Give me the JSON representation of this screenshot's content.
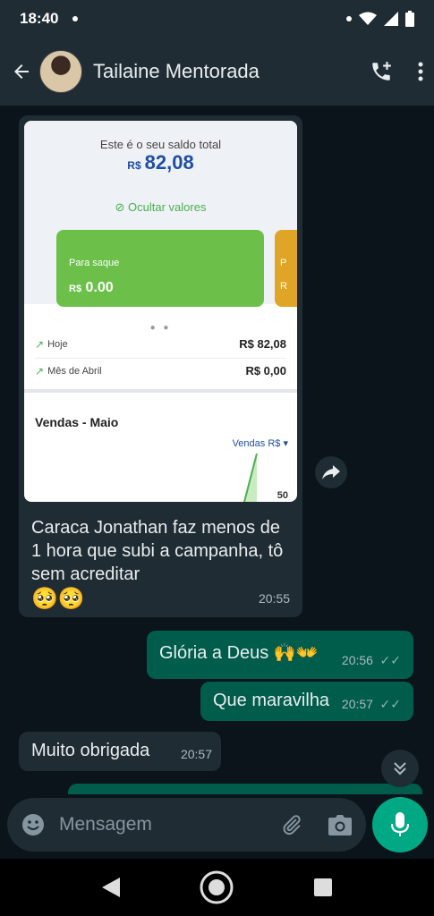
{
  "status_bar": {
    "time": "18:40"
  },
  "header": {
    "contact_name": "Tailaine Mentorada"
  },
  "messages": {
    "m1": {
      "screenshot": {
        "saldo_label": "Este é o seu saldo total",
        "saldo_currency": "R$",
        "saldo_value": "82,08",
        "hide_values": "Ocultar valores",
        "card_green_label": "Para saque",
        "card_green_currency": "R$",
        "card_green_value": "0.00",
        "card_yellow_label": "P",
        "card_yellow_value": "R",
        "row_today_label": "Hoje",
        "row_today_value": "R$  82,08",
        "row_month_label": "Mês de Abril",
        "row_month_value": "R$  0,00",
        "sales_title": "Vendas - Maio",
        "sales_select": "Vendas R$",
        "chart_tick": "50"
      },
      "text": "Caraca Jonathan faz menos de 1 hora que subi a campanha, tô sem acreditar",
      "emoji": "🥺🥺",
      "time": "20:55"
    },
    "m2": {
      "text": "Glória a Deus 🙌👐",
      "time": "20:56"
    },
    "m3": {
      "text": "Que maravilha",
      "time": "20:57"
    },
    "m4": {
      "text": "Muito obrigada",
      "time": "20:57"
    }
  },
  "input": {
    "placeholder": "Mensagem"
  },
  "colors": {
    "chat_background": "#0b141a",
    "incoming_bubble": "#1f2c34",
    "outgoing_bubble": "#005c4b",
    "accent": "#00a884"
  }
}
